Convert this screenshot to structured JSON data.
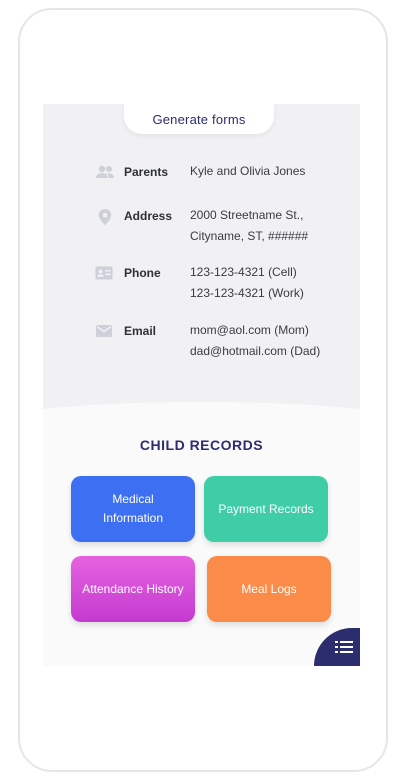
{
  "header": {
    "generate_forms_label": "Generate forms"
  },
  "contact": [
    {
      "label": "Parents",
      "icon": "people-icon",
      "lines": [
        "Kyle and Olivia Jones"
      ]
    },
    {
      "label": "Address",
      "icon": "location-pin-icon",
      "lines": [
        "2000 Streetname St.,",
        "Cityname, ST, ######"
      ]
    },
    {
      "label": "Phone",
      "icon": "contact-card-icon",
      "lines": [
        "123-123-4321 (Cell)",
        "123-123-4321 (Work)"
      ]
    },
    {
      "label": "Email",
      "icon": "mail-icon",
      "lines": [
        "mom@aol.com (Mom)",
        "dad@hotmail.com (Dad)"
      ]
    }
  ],
  "records": {
    "title": "CHILD RECORDS",
    "tiles": [
      {
        "label": "Medical Information",
        "color": "#3d6ff2"
      },
      {
        "label": "Payment Records",
        "color": "#3fcda8"
      },
      {
        "label": "Attendance History",
        "color": "#d44ad8"
      },
      {
        "label": "Meal Logs",
        "color": "#fb8b48"
      }
    ]
  },
  "menu_button_icon": "list-menu-icon",
  "colors": {
    "primary": "#2b2d6e",
    "icon_gray": "#cdd0d8",
    "panel_bg": "#f1f1f4"
  }
}
